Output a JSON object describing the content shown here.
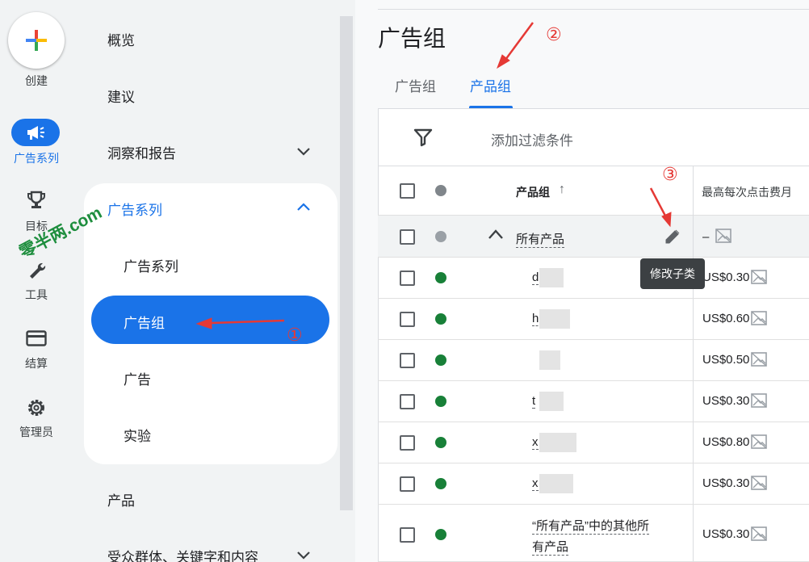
{
  "rail": {
    "create_label": "创建",
    "items": [
      {
        "label": "广告系列",
        "icon": "megaphone-icon",
        "active": true
      },
      {
        "label": "目标",
        "icon": "trophy-icon"
      },
      {
        "label": "工具",
        "icon": "wrench-icon"
      },
      {
        "label": "结算",
        "icon": "credit-card-icon"
      },
      {
        "label": "管理员",
        "icon": "gear-icon"
      }
    ]
  },
  "nav": {
    "overview": "概览",
    "recommendations": "建议",
    "insights": "洞察和报告",
    "campaigns_section": "广告系列",
    "sub_campaigns": "广告系列",
    "sub_adgroups": "广告组",
    "sub_ads": "广告",
    "sub_experiments": "实验",
    "products": "产品",
    "audiences": "受众群体、关键字和内容"
  },
  "watermark": "零半两.com",
  "main": {
    "title": "广告组",
    "tabs": [
      {
        "label": "广告组",
        "active": false
      },
      {
        "label": "产品组",
        "active": true
      }
    ],
    "filter_placeholder": "添加过滤条件",
    "columns": {
      "product_group": "产品组",
      "sort_indicator": "↑",
      "max_cpc": "最高每次点击费月"
    },
    "all_products_row": {
      "label": "所有产品",
      "cpc": "–"
    },
    "tooltip": "修改子类",
    "rows": [
      {
        "label": "d",
        "cpc": "US$0.30"
      },
      {
        "label": "hl",
        "cpc": "US$0.60"
      },
      {
        "label": "",
        "cpc": "US$0.50"
      },
      {
        "label": "t",
        "cpc": "US$0.30"
      },
      {
        "label": "x",
        "cpc": "US$0.80"
      },
      {
        "label": "x",
        "cpc": "US$0.30"
      }
    ],
    "other_row": {
      "line1": "“所有产品”中的其他所",
      "line2": "有产品",
      "cpc": "US$0.30"
    }
  },
  "annotations": {
    "one": "①",
    "two": "②",
    "three": "③"
  },
  "colors": {
    "accent": "#1a73e8",
    "status_green": "#188038",
    "annotation_red": "#e53935"
  }
}
